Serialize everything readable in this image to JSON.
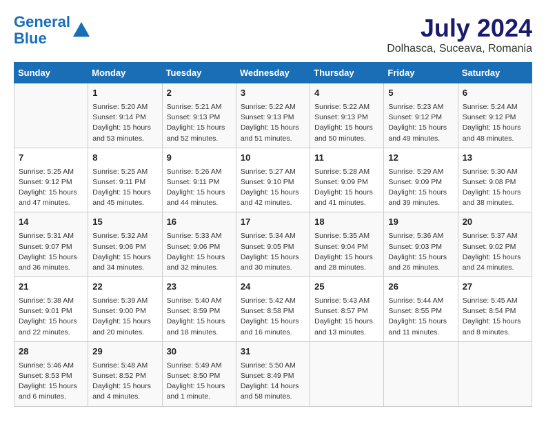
{
  "header": {
    "logo_line1": "General",
    "logo_line2": "Blue",
    "month_year": "July 2024",
    "location": "Dolhasca, Suceava, Romania"
  },
  "weekdays": [
    "Sunday",
    "Monday",
    "Tuesday",
    "Wednesday",
    "Thursday",
    "Friday",
    "Saturday"
  ],
  "weeks": [
    [
      {
        "day": "",
        "info": ""
      },
      {
        "day": "1",
        "info": "Sunrise: 5:20 AM\nSunset: 9:14 PM\nDaylight: 15 hours\nand 53 minutes."
      },
      {
        "day": "2",
        "info": "Sunrise: 5:21 AM\nSunset: 9:13 PM\nDaylight: 15 hours\nand 52 minutes."
      },
      {
        "day": "3",
        "info": "Sunrise: 5:22 AM\nSunset: 9:13 PM\nDaylight: 15 hours\nand 51 minutes."
      },
      {
        "day": "4",
        "info": "Sunrise: 5:22 AM\nSunset: 9:13 PM\nDaylight: 15 hours\nand 50 minutes."
      },
      {
        "day": "5",
        "info": "Sunrise: 5:23 AM\nSunset: 9:12 PM\nDaylight: 15 hours\nand 49 minutes."
      },
      {
        "day": "6",
        "info": "Sunrise: 5:24 AM\nSunset: 9:12 PM\nDaylight: 15 hours\nand 48 minutes."
      }
    ],
    [
      {
        "day": "7",
        "info": "Sunrise: 5:25 AM\nSunset: 9:12 PM\nDaylight: 15 hours\nand 47 minutes."
      },
      {
        "day": "8",
        "info": "Sunrise: 5:25 AM\nSunset: 9:11 PM\nDaylight: 15 hours\nand 45 minutes."
      },
      {
        "day": "9",
        "info": "Sunrise: 5:26 AM\nSunset: 9:11 PM\nDaylight: 15 hours\nand 44 minutes."
      },
      {
        "day": "10",
        "info": "Sunrise: 5:27 AM\nSunset: 9:10 PM\nDaylight: 15 hours\nand 42 minutes."
      },
      {
        "day": "11",
        "info": "Sunrise: 5:28 AM\nSunset: 9:09 PM\nDaylight: 15 hours\nand 41 minutes."
      },
      {
        "day": "12",
        "info": "Sunrise: 5:29 AM\nSunset: 9:09 PM\nDaylight: 15 hours\nand 39 minutes."
      },
      {
        "day": "13",
        "info": "Sunrise: 5:30 AM\nSunset: 9:08 PM\nDaylight: 15 hours\nand 38 minutes."
      }
    ],
    [
      {
        "day": "14",
        "info": "Sunrise: 5:31 AM\nSunset: 9:07 PM\nDaylight: 15 hours\nand 36 minutes."
      },
      {
        "day": "15",
        "info": "Sunrise: 5:32 AM\nSunset: 9:06 PM\nDaylight: 15 hours\nand 34 minutes."
      },
      {
        "day": "16",
        "info": "Sunrise: 5:33 AM\nSunset: 9:06 PM\nDaylight: 15 hours\nand 32 minutes."
      },
      {
        "day": "17",
        "info": "Sunrise: 5:34 AM\nSunset: 9:05 PM\nDaylight: 15 hours\nand 30 minutes."
      },
      {
        "day": "18",
        "info": "Sunrise: 5:35 AM\nSunset: 9:04 PM\nDaylight: 15 hours\nand 28 minutes."
      },
      {
        "day": "19",
        "info": "Sunrise: 5:36 AM\nSunset: 9:03 PM\nDaylight: 15 hours\nand 26 minutes."
      },
      {
        "day": "20",
        "info": "Sunrise: 5:37 AM\nSunset: 9:02 PM\nDaylight: 15 hours\nand 24 minutes."
      }
    ],
    [
      {
        "day": "21",
        "info": "Sunrise: 5:38 AM\nSunset: 9:01 PM\nDaylight: 15 hours\nand 22 minutes."
      },
      {
        "day": "22",
        "info": "Sunrise: 5:39 AM\nSunset: 9:00 PM\nDaylight: 15 hours\nand 20 minutes."
      },
      {
        "day": "23",
        "info": "Sunrise: 5:40 AM\nSunset: 8:59 PM\nDaylight: 15 hours\nand 18 minutes."
      },
      {
        "day": "24",
        "info": "Sunrise: 5:42 AM\nSunset: 8:58 PM\nDaylight: 15 hours\nand 16 minutes."
      },
      {
        "day": "25",
        "info": "Sunrise: 5:43 AM\nSunset: 8:57 PM\nDaylight: 15 hours\nand 13 minutes."
      },
      {
        "day": "26",
        "info": "Sunrise: 5:44 AM\nSunset: 8:55 PM\nDaylight: 15 hours\nand 11 minutes."
      },
      {
        "day": "27",
        "info": "Sunrise: 5:45 AM\nSunset: 8:54 PM\nDaylight: 15 hours\nand 8 minutes."
      }
    ],
    [
      {
        "day": "28",
        "info": "Sunrise: 5:46 AM\nSunset: 8:53 PM\nDaylight: 15 hours\nand 6 minutes."
      },
      {
        "day": "29",
        "info": "Sunrise: 5:48 AM\nSunset: 8:52 PM\nDaylight: 15 hours\nand 4 minutes."
      },
      {
        "day": "30",
        "info": "Sunrise: 5:49 AM\nSunset: 8:50 PM\nDaylight: 15 hours\nand 1 minute."
      },
      {
        "day": "31",
        "info": "Sunrise: 5:50 AM\nSunset: 8:49 PM\nDaylight: 14 hours\nand 58 minutes."
      },
      {
        "day": "",
        "info": ""
      },
      {
        "day": "",
        "info": ""
      },
      {
        "day": "",
        "info": ""
      }
    ]
  ]
}
